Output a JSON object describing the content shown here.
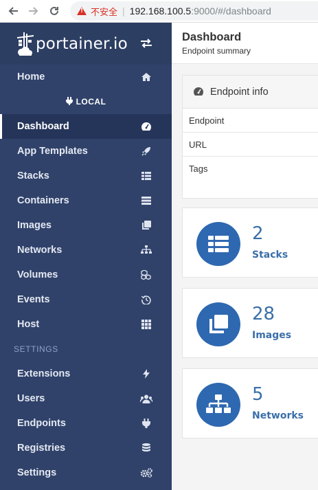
{
  "browser": {
    "insecure_label": "不安全",
    "url_host": "192.168.100.5",
    "url_path": ":9000/#/dashboard"
  },
  "brand": {
    "name": "portainer.io"
  },
  "sidebar": {
    "home": "Home",
    "endpoint": "LOCAL",
    "items": [
      {
        "label": "Dashboard",
        "icon": "tachometer-icon",
        "active": true
      },
      {
        "label": "App Templates",
        "icon": "rocket-icon"
      },
      {
        "label": "Stacks",
        "icon": "th-list-icon"
      },
      {
        "label": "Containers",
        "icon": "server-icon"
      },
      {
        "label": "Images",
        "icon": "clone-icon"
      },
      {
        "label": "Networks",
        "icon": "sitemap-icon"
      },
      {
        "label": "Volumes",
        "icon": "cubes-icon"
      },
      {
        "label": "Events",
        "icon": "history-icon"
      },
      {
        "label": "Host",
        "icon": "th-icon"
      }
    ],
    "settings_title": "SETTINGS",
    "settings_items": [
      {
        "label": "Extensions",
        "icon": "bolt-icon"
      },
      {
        "label": "Users",
        "icon": "users-icon"
      },
      {
        "label": "Endpoints",
        "icon": "plug-icon"
      },
      {
        "label": "Registries",
        "icon": "database-icon"
      },
      {
        "label": "Settings",
        "icon": "cogs-icon"
      }
    ]
  },
  "header": {
    "title": "Dashboard",
    "subtitle": "Endpoint summary"
  },
  "endpoint_info": {
    "title": "Endpoint info",
    "rows": [
      "Endpoint",
      "URL",
      "Tags"
    ]
  },
  "stats": [
    {
      "value": "2",
      "label": "Stacks"
    },
    {
      "value": "28",
      "label": "Images"
    },
    {
      "value": "5",
      "label": "Networks"
    }
  ],
  "colors": {
    "sidebar": "#30426a",
    "accent": "#2e68b0",
    "stat_text": "#3a6fa8"
  }
}
